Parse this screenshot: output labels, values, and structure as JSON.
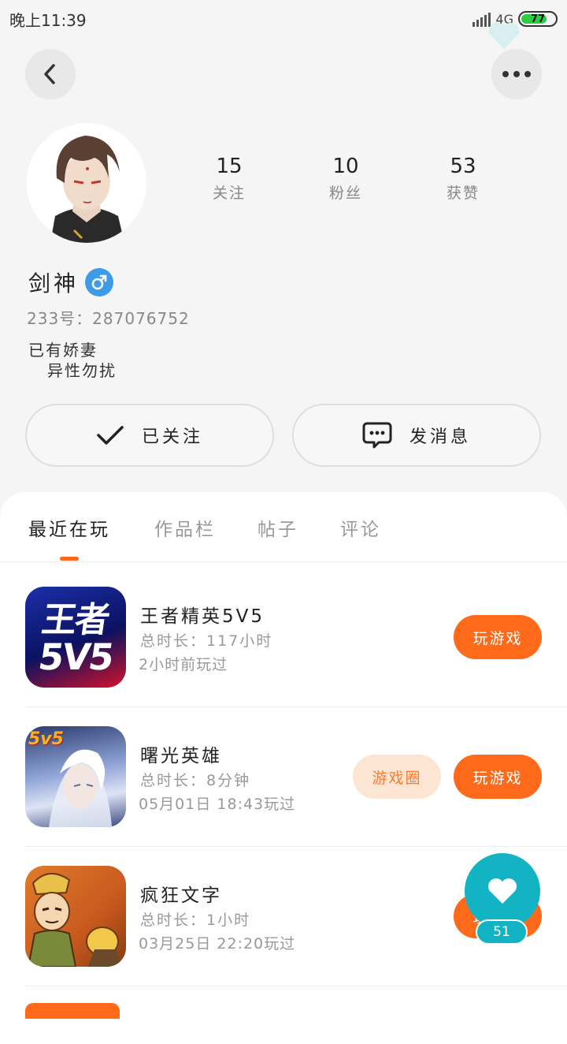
{
  "status_bar": {
    "time": "晚上11:39",
    "network": "4G",
    "battery_level": "77"
  },
  "profile": {
    "nickname": "剑神",
    "gender_icon": "male-icon",
    "user_id": "233号：287076752",
    "bio_line1": "已有娇妻",
    "bio_line2": "异性勿扰",
    "stats": [
      {
        "value": "15",
        "label": "关注"
      },
      {
        "value": "10",
        "label": "粉丝"
      },
      {
        "value": "53",
        "label": "获赞"
      }
    ]
  },
  "actions": {
    "follow_label": "已关注",
    "message_label": "发消息"
  },
  "tabs": [
    {
      "label": "最近在玩",
      "active": true
    },
    {
      "label": "作品栏",
      "active": false
    },
    {
      "label": "帖子",
      "active": false
    },
    {
      "label": "评论",
      "active": false
    }
  ],
  "games": [
    {
      "name": "王者精英5V5",
      "total_time": "总时长：117小时",
      "last_played": "2小时前玩过",
      "play_label": "玩游戏",
      "icon_text_top": "王者",
      "icon_text_bottom": "5V5"
    },
    {
      "name": "曙光英雄",
      "total_time": "总时长：8分钟",
      "last_played": "05月01日 18:43玩过",
      "circle_label": "游戏圈",
      "play_label": "玩游戏",
      "icon_badge": "5v5"
    },
    {
      "name": "疯狂文字",
      "total_time": "总时长：1小时",
      "last_played": "03月25日 22:20玩过",
      "play_label": "玩游戏"
    }
  ],
  "like_fab": {
    "count": "51"
  },
  "colors": {
    "accent": "#ff6a1a",
    "fab": "#12b4c4",
    "gender": "#3d9be9",
    "battery": "#2ecc40"
  }
}
